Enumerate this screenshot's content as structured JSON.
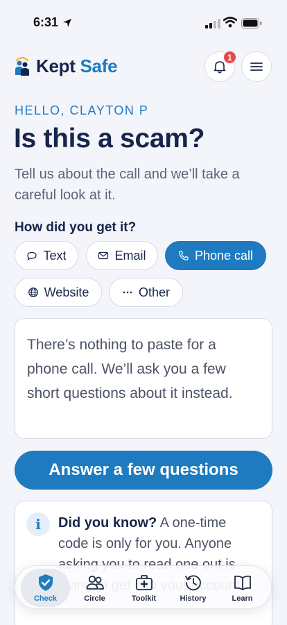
{
  "status_bar": {
    "time": "6:31"
  },
  "app": {
    "logo_kept": "Kept",
    "logo_safe": "Safe",
    "notification_count": "1"
  },
  "main": {
    "greeting": "HELLO, CLAYTON P",
    "title": "Is this a scam?",
    "subtitle": "Tell us about the call and we’ll take a careful look at it.",
    "source_question": "How did you get it?",
    "sources": [
      {
        "label": "Text",
        "icon": "chat-bubble-icon",
        "selected": false
      },
      {
        "label": "Email",
        "icon": "envelope-icon",
        "selected": false
      },
      {
        "label": "Phone call",
        "icon": "phone-icon",
        "selected": true
      },
      {
        "label": "Website",
        "icon": "globe-icon",
        "selected": false
      },
      {
        "label": "Other",
        "icon": "ellipsis-icon",
        "selected": false
      }
    ],
    "phone_note": "There’s nothing to paste for a phone call. We’ll ask you a few short questions about it instead.",
    "primary_button": "Answer a few questions",
    "tip": {
      "heading": "Did you know?",
      "body": " A one-time code is only for you. Anyone asking you to read one out is trying to get into your account."
    }
  },
  "tab_bar": {
    "tabs": [
      {
        "label": "Check",
        "icon": "shield-check-icon",
        "active": true
      },
      {
        "label": "Circle",
        "icon": "people-icon",
        "active": false
      },
      {
        "label": "Toolkit",
        "icon": "medkit-icon",
        "active": false
      },
      {
        "label": "History",
        "icon": "history-icon",
        "active": false
      },
      {
        "label": "Learn",
        "icon": "book-icon",
        "active": false
      }
    ]
  },
  "colors": {
    "accent": "#1f7bc0",
    "navy": "#17254a",
    "background": "#f4f5fb",
    "badge": "#e24b4b"
  }
}
